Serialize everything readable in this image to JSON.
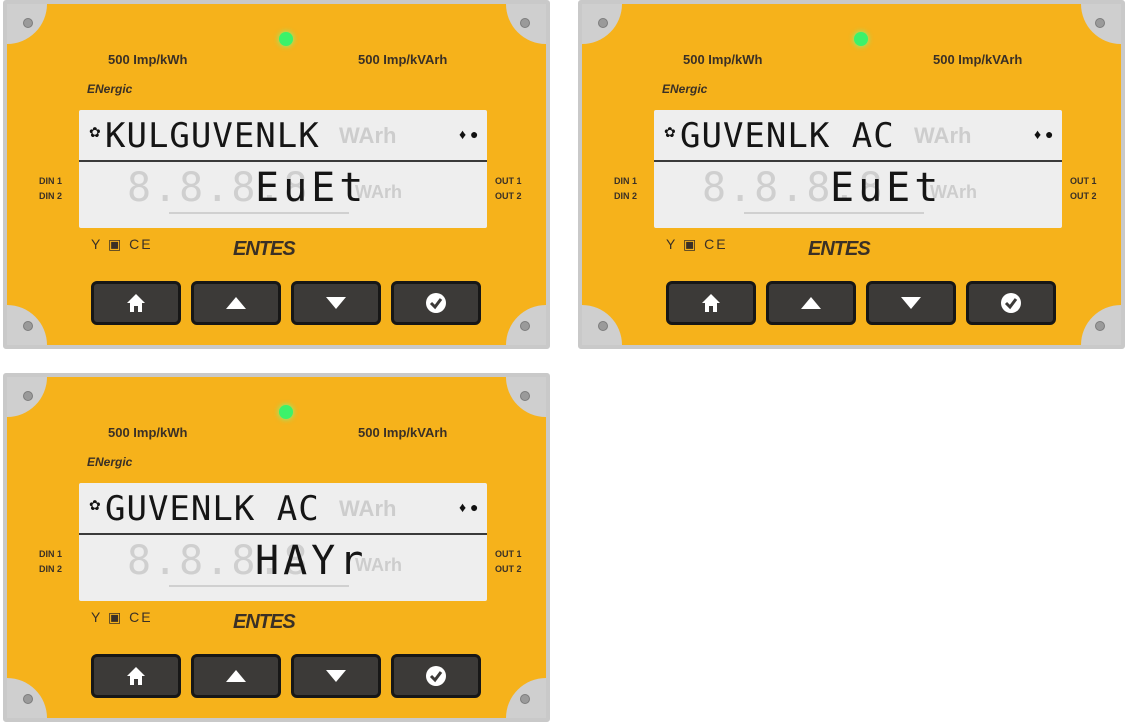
{
  "meters": [
    {
      "imp_kwh": "500 Imp/kWh",
      "imp_kvarh": "500 Imp/kVArh",
      "brand": "ENergic",
      "lcd_top": "KULGUVENLK",
      "lcd_bottom": "EuEt",
      "din1": "DIN 1",
      "din2": "DIN 2",
      "out1": "OUT 1",
      "out2": "OUT 2",
      "logo": "ENTES"
    },
    {
      "imp_kwh": "500 Imp/kWh",
      "imp_kvarh": "500 Imp/kVArh",
      "brand": "ENergic",
      "lcd_top": "GUVENLK AC",
      "lcd_bottom": "EuEt",
      "din1": "DIN 1",
      "din2": "DIN 2",
      "out1": "OUT 1",
      "out2": "OUT 2",
      "logo": "ENTES"
    },
    {
      "imp_kwh": "500 Imp/kWh",
      "imp_kvarh": "500 Imp/kVArh",
      "brand": "ENergic",
      "lcd_top": "GUVENLK AC",
      "lcd_bottom": "HAYr",
      "din1": "DIN 1",
      "din2": "DIN 2",
      "out1": "OUT 1",
      "out2": "OUT 2",
      "logo": "ENTES"
    }
  ],
  "icons": {
    "led": "status-led-icon",
    "home": "home-icon",
    "up": "arrow-up-icon",
    "down": "arrow-down-icon",
    "ok": "check-icon",
    "gear": "gear-icon"
  },
  "colors": {
    "panel": "#f6b21b",
    "led": "#3cf26a",
    "lcd": "#eeeeee",
    "button": "#3c3a38"
  }
}
